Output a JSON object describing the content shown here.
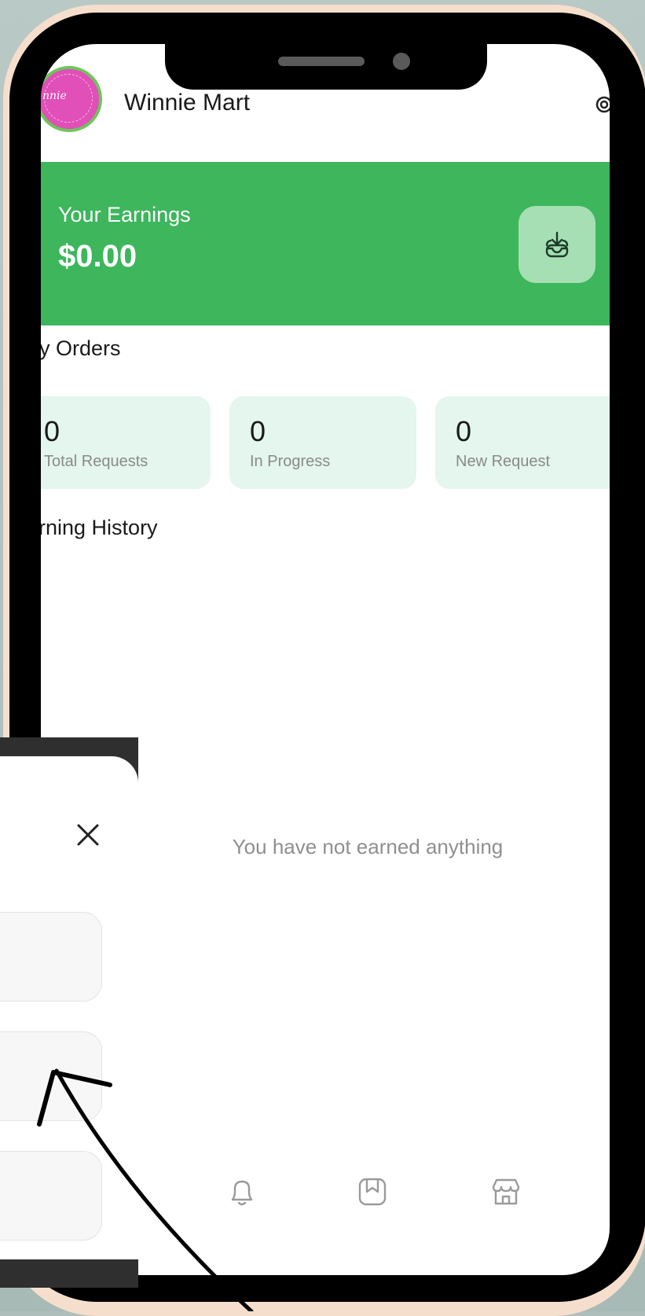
{
  "header": {
    "store_name": "Winnie Mart",
    "avatar_text": "nnie"
  },
  "earnings": {
    "label": "Your Earnings",
    "amount": "$0.00"
  },
  "orders": {
    "title": "y Orders",
    "stats": [
      {
        "value": "0",
        "label": "Total Requests"
      },
      {
        "value": "0",
        "label": "In Progress"
      },
      {
        "value": "0",
        "label": "New Request"
      }
    ]
  },
  "history": {
    "title": "arning History",
    "empty_message": "You have not earned anything"
  },
  "bottom_nav": [
    "bell-icon",
    "bookmark-icon",
    "store-icon"
  ],
  "colors": {
    "accent": "#3db65c",
    "accent_light": "#a6dfb4",
    "stat_bg": "#e4f6ee"
  }
}
